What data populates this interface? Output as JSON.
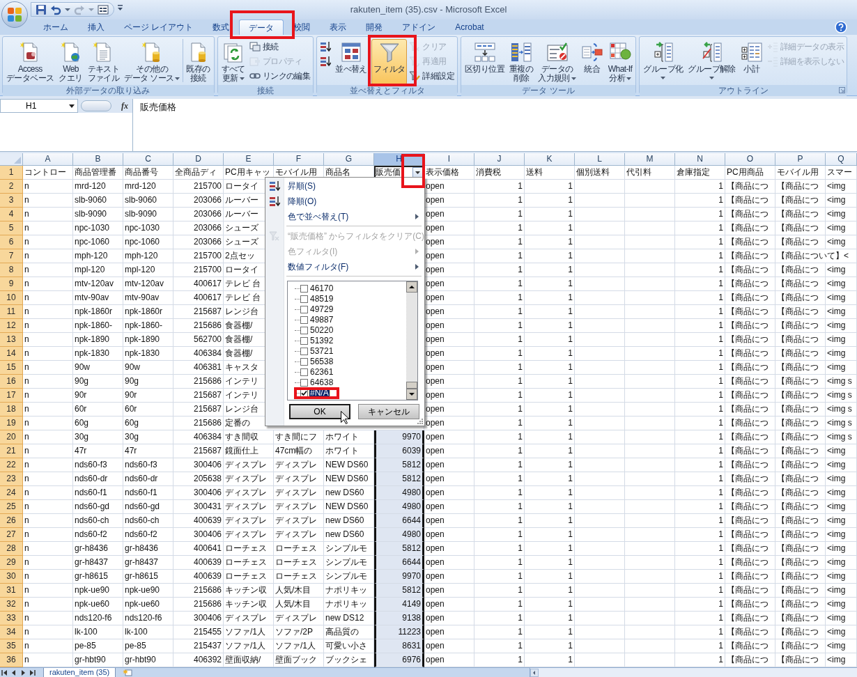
{
  "window": {
    "title": "rakuten_item (35).csv - Microsoft Excel"
  },
  "ribbon_tabs": [
    {
      "label": "ホーム",
      "selected": false,
      "highlighted": false
    },
    {
      "label": "挿入",
      "selected": false,
      "highlighted": false
    },
    {
      "label": "ページ レイアウト",
      "selected": false,
      "highlighted": false
    },
    {
      "label": "数式",
      "selected": false,
      "highlighted": false
    },
    {
      "label": "データ",
      "selected": true,
      "highlighted": true
    },
    {
      "label": "校閲",
      "selected": false,
      "highlighted": false
    },
    {
      "label": "表示",
      "selected": false,
      "highlighted": false
    },
    {
      "label": "開発",
      "selected": false,
      "highlighted": false
    },
    {
      "label": "アドイン",
      "selected": false,
      "highlighted": false
    },
    {
      "label": "Acrobat",
      "selected": false,
      "highlighted": false
    }
  ],
  "ribbon_groups": [
    {
      "label": "外部データの取り込み",
      "launcher": false,
      "items": [
        {
          "kind": "large",
          "lines": [
            "Access",
            "データベース"
          ],
          "disabled": false,
          "on": false,
          "menu": false,
          "highlighted": false
        },
        {
          "kind": "large",
          "lines": [
            "Web",
            "クエリ"
          ],
          "disabled": false,
          "on": false,
          "menu": false,
          "highlighted": false
        },
        {
          "kind": "large",
          "lines": [
            "テキスト",
            "ファイル"
          ],
          "disabled": false,
          "on": false,
          "menu": false,
          "highlighted": false
        },
        {
          "kind": "large",
          "lines": [
            "その他の",
            "データ ソース"
          ],
          "disabled": false,
          "on": false,
          "menu": true,
          "highlighted": false
        },
        {
          "kind": "divider"
        },
        {
          "kind": "large",
          "lines": [
            "既存の",
            "接続"
          ],
          "disabled": false,
          "on": false,
          "menu": false,
          "highlighted": false
        }
      ]
    },
    {
      "label": "接続",
      "launcher": false,
      "items": [
        {
          "kind": "large",
          "lines": [
            "すべて",
            "更新"
          ],
          "disabled": false,
          "on": false,
          "menu": true,
          "highlighted": false
        },
        {
          "kind": "small",
          "lines": [
            "接続"
          ],
          "disabled": false,
          "on": false,
          "menu": false,
          "highlighted": false
        },
        {
          "kind": "small",
          "lines": [
            "プロパティ"
          ],
          "disabled": true,
          "on": false,
          "menu": false,
          "highlighted": false
        },
        {
          "kind": "small",
          "lines": [
            "リンクの編集"
          ],
          "disabled": false,
          "on": false,
          "menu": false,
          "highlighted": false
        }
      ]
    },
    {
      "label": "並べ替えとフィルタ",
      "launcher": false,
      "items": [
        {
          "kind": "icon",
          "disabled": false,
          "on": false,
          "menu": false,
          "highlighted": false
        },
        {
          "kind": "icon",
          "disabled": false,
          "on": false,
          "menu": false,
          "highlighted": false
        },
        {
          "kind": "large",
          "lines": [
            "並べ替え"
          ],
          "disabled": false,
          "on": false,
          "menu": false,
          "highlighted": false
        },
        {
          "kind": "divider"
        },
        {
          "kind": "large",
          "lines": [
            "フィルタ"
          ],
          "disabled": false,
          "on": true,
          "menu": false,
          "highlighted": true
        },
        {
          "kind": "small",
          "lines": [
            "クリア"
          ],
          "disabled": true,
          "on": false,
          "menu": false,
          "highlighted": false
        },
        {
          "kind": "small",
          "lines": [
            "再適用"
          ],
          "disabled": true,
          "on": false,
          "menu": false,
          "highlighted": false
        },
        {
          "kind": "small",
          "lines": [
            "詳細設定"
          ],
          "disabled": false,
          "on": false,
          "menu": false,
          "highlighted": false
        }
      ]
    },
    {
      "label": "データ ツール",
      "launcher": false,
      "items": [
        {
          "kind": "large",
          "lines": [
            "区切り位置"
          ],
          "disabled": false,
          "on": false,
          "menu": false,
          "highlighted": false
        },
        {
          "kind": "large",
          "lines": [
            "重複の",
            "削除"
          ],
          "disabled": false,
          "on": false,
          "menu": false,
          "highlighted": false
        },
        {
          "kind": "large",
          "lines": [
            "データの",
            "入力規則"
          ],
          "disabled": false,
          "on": false,
          "menu": true,
          "highlighted": false
        },
        {
          "kind": "large",
          "lines": [
            "統合"
          ],
          "disabled": false,
          "on": false,
          "menu": false,
          "highlighted": false
        },
        {
          "kind": "large",
          "lines": [
            "What-If",
            "分析"
          ],
          "disabled": false,
          "on": false,
          "menu": true,
          "highlighted": false
        }
      ]
    },
    {
      "label": "アウトライン",
      "launcher": true,
      "items": [
        {
          "kind": "large",
          "lines": [
            "グループ化"
          ],
          "disabled": false,
          "on": false,
          "menu": true,
          "highlighted": false
        },
        {
          "kind": "large",
          "lines": [
            "グループ解除"
          ],
          "disabled": false,
          "on": false,
          "menu": true,
          "highlighted": false
        },
        {
          "kind": "large",
          "lines": [
            "小計"
          ],
          "disabled": false,
          "on": false,
          "menu": false,
          "highlighted": false
        },
        {
          "kind": "small",
          "lines": [
            "詳細データの表示"
          ],
          "disabled": true,
          "on": false,
          "menu": false,
          "highlighted": false
        },
        {
          "kind": "small",
          "lines": [
            "詳細を表示しない"
          ],
          "disabled": true,
          "on": false,
          "menu": false,
          "highlighted": false
        }
      ]
    }
  ],
  "formula_bar": {
    "cell_name": "H1",
    "function_button": "fx",
    "value": "販売価格"
  },
  "sheet": {
    "columns": [
      {
        "letter": "A",
        "selected": false,
        "filter_button": false,
        "highlighted": false
      },
      {
        "letter": "B",
        "selected": false,
        "filter_button": false,
        "highlighted": false
      },
      {
        "letter": "C",
        "selected": false,
        "filter_button": false,
        "highlighted": false
      },
      {
        "letter": "D",
        "selected": false,
        "filter_button": false,
        "highlighted": false
      },
      {
        "letter": "E",
        "selected": false,
        "filter_button": false,
        "highlighted": false
      },
      {
        "letter": "F",
        "selected": false,
        "filter_button": false,
        "highlighted": false
      },
      {
        "letter": "G",
        "selected": false,
        "filter_button": false,
        "highlighted": false
      },
      {
        "letter": "H",
        "selected": true,
        "filter_button": true,
        "highlighted": true
      },
      {
        "letter": "I",
        "selected": false,
        "filter_button": false,
        "highlighted": false
      },
      {
        "letter": "J",
        "selected": false,
        "filter_button": false,
        "highlighted": false
      },
      {
        "letter": "K",
        "selected": false,
        "filter_button": false,
        "highlighted": false
      },
      {
        "letter": "L",
        "selected": false,
        "filter_button": false,
        "highlighted": false
      },
      {
        "letter": "M",
        "selected": false,
        "filter_button": false,
        "highlighted": false
      },
      {
        "letter": "N",
        "selected": false,
        "filter_button": false,
        "highlighted": false
      },
      {
        "letter": "O",
        "selected": false,
        "filter_button": false,
        "highlighted": false
      },
      {
        "letter": "P",
        "selected": false,
        "filter_button": false,
        "highlighted": false
      },
      {
        "letter": "Q",
        "selected": false,
        "filter_button": false,
        "highlighted": false
      }
    ],
    "rows": [
      {
        "number": "1",
        "cells": [
          "コントロー",
          "商品管理番",
          "商品番号",
          "全商品ディ",
          "PC用キャッ",
          "モバイル用",
          "商品名",
          "販売価",
          "表示価格",
          "消費税",
          "送料",
          "個別送料",
          "代引料",
          "倉庫指定",
          "PC用商品",
          "モバイル用",
          "スマー"
        ]
      },
      {
        "number": "2",
        "cells": [
          "n",
          "mrd-120",
          "mrd-120",
          "215700",
          "ロータイ",
          null,
          null,
          null,
          "open",
          "1",
          "1",
          null,
          null,
          "1",
          "【商品につ",
          "【商品につ",
          "<img"
        ]
      },
      {
        "number": "3",
        "cells": [
          "n",
          "slb-9060",
          "slb-9060",
          "203066",
          "ルーバー",
          null,
          null,
          null,
          "open",
          "1",
          "1",
          null,
          null,
          "1",
          "【商品につ",
          "【商品につ",
          "<img"
        ]
      },
      {
        "number": "4",
        "cells": [
          "n",
          "slb-9090",
          "slb-9090",
          "203066",
          "ルーバー",
          null,
          null,
          null,
          "open",
          "1",
          "1",
          null,
          null,
          "1",
          "【商品につ",
          "【商品につ",
          "<img"
        ]
      },
      {
        "number": "5",
        "cells": [
          "n",
          "npc-1030",
          "npc-1030",
          "203066",
          "シューズ",
          null,
          null,
          null,
          "open",
          "1",
          "1",
          null,
          null,
          "1",
          "【商品につ",
          "【商品につ",
          "<img"
        ]
      },
      {
        "number": "6",
        "cells": [
          "n",
          "npc-1060",
          "npc-1060",
          "203066",
          "シューズ",
          null,
          null,
          null,
          "open",
          "1",
          "1",
          null,
          null,
          "1",
          "【商品につ",
          "【商品につ",
          "<img"
        ]
      },
      {
        "number": "7",
        "cells": [
          "n",
          "mph-120",
          "mph-120",
          "215700",
          "2点セッ",
          null,
          null,
          null,
          "open",
          "1",
          "1",
          null,
          null,
          "1",
          "【商品につ",
          "【商品について】<",
          null
        ]
      },
      {
        "number": "8",
        "cells": [
          "n",
          "mpl-120",
          "mpl-120",
          "215700",
          "ロータイ",
          null,
          null,
          null,
          "open",
          "1",
          "1",
          null,
          null,
          "1",
          "【商品につ",
          "【商品につ",
          "<img"
        ]
      },
      {
        "number": "9",
        "cells": [
          "n",
          "mtv-120av",
          "mtv-120av",
          "400617",
          "テレビ 台",
          null,
          null,
          null,
          "open",
          "1",
          "1",
          null,
          null,
          "1",
          "【商品につ",
          "【商品につ",
          "<img"
        ]
      },
      {
        "number": "10",
        "cells": [
          "n",
          "mtv-90av",
          "mtv-90av",
          "400617",
          "テレビ 台",
          null,
          null,
          null,
          "open",
          "1",
          "1",
          null,
          null,
          "1",
          "【商品につ",
          "【商品につ",
          "<img"
        ]
      },
      {
        "number": "11",
        "cells": [
          "n",
          "npk-1860r",
          "npk-1860r",
          "215687",
          "レンジ台",
          null,
          null,
          null,
          "open",
          "1",
          "1",
          null,
          null,
          "1",
          "【商品につ",
          "【商品につ",
          "<img"
        ]
      },
      {
        "number": "12",
        "cells": [
          "n",
          "npk-1860-",
          "npk-1860-",
          "215686",
          "食器棚/",
          null,
          null,
          null,
          "open",
          "1",
          "1",
          null,
          null,
          "1",
          "【商品につ",
          "【商品につ",
          "<img"
        ]
      },
      {
        "number": "13",
        "cells": [
          "n",
          "npk-1890",
          "npk-1890",
          "562700",
          "食器棚/",
          null,
          null,
          null,
          "open",
          "1",
          "1",
          null,
          null,
          "1",
          "【商品につ",
          "【商品につ",
          "<img"
        ]
      },
      {
        "number": "14",
        "cells": [
          "n",
          "npk-1830",
          "npk-1830",
          "406384",
          "食器棚/",
          null,
          null,
          null,
          "open",
          "1",
          "1",
          null,
          null,
          "1",
          "【商品につ",
          "【商品につ",
          "<img"
        ]
      },
      {
        "number": "15",
        "cells": [
          "n",
          "90w",
          "90w",
          "406381",
          "キャスタ",
          null,
          null,
          null,
          "open",
          "1",
          "1",
          null,
          null,
          "1",
          "【商品につ",
          "【商品につ",
          "<img"
        ]
      },
      {
        "number": "16",
        "cells": [
          "n",
          "90g",
          "90g",
          "215686",
          "インテリ",
          null,
          null,
          null,
          "open",
          "1",
          "1",
          null,
          null,
          "1",
          "【商品につ",
          "【商品につ",
          "<img s"
        ]
      },
      {
        "number": "17",
        "cells": [
          "n",
          "90r",
          "90r",
          "215687",
          "インテリ",
          null,
          null,
          null,
          "open",
          "1",
          "1",
          null,
          null,
          "1",
          "【商品につ",
          "【商品につ",
          "<img s"
        ]
      },
      {
        "number": "18",
        "cells": [
          "n",
          "60r",
          "60r",
          "215687",
          "レンジ台",
          null,
          null,
          null,
          "open",
          "1",
          "1",
          null,
          null,
          "1",
          "【商品につ",
          "【商品につ",
          "<img s"
        ]
      },
      {
        "number": "19",
        "cells": [
          "n",
          "60g",
          "60g",
          "215686",
          "定番の",
          null,
          null,
          null,
          "open",
          "1",
          "1",
          null,
          null,
          "1",
          "【商品につ",
          "【商品につ",
          "<img s"
        ]
      },
      {
        "number": "20",
        "cells": [
          "n",
          "30g",
          "30g",
          "406384",
          "すき間収",
          "すき間にフ",
          "ホワイト",
          "9970",
          "open",
          "1",
          "1",
          null,
          null,
          "1",
          "【商品につ",
          "【商品につ",
          "<img s"
        ]
      },
      {
        "number": "21",
        "cells": [
          "n",
          "47r",
          "47r",
          "215687",
          "鏡面仕上",
          "47cm幅の",
          "ホワイト",
          "6039",
          "open",
          "1",
          "1",
          null,
          null,
          "1",
          "【商品につ",
          "【商品につ",
          "<img"
        ]
      },
      {
        "number": "22",
        "cells": [
          "n",
          "nds60-f3",
          "nds60-f3",
          "300406",
          "ディスプレ",
          "ディスプレ",
          "NEW DS60",
          "5812",
          "open",
          "1",
          "1",
          null,
          null,
          "1",
          "【商品につ",
          "【商品につ",
          "<img"
        ]
      },
      {
        "number": "23",
        "cells": [
          "n",
          "nds60-dr",
          "nds60-dr",
          "205638",
          "ディスプレ",
          "ディスプレ",
          "NEW DS60",
          "5812",
          "open",
          "1",
          "1",
          null,
          null,
          "1",
          "【商品につ",
          "【商品につ",
          "<img"
        ]
      },
      {
        "number": "24",
        "cells": [
          "n",
          "nds60-f1",
          "nds60-f1",
          "300406",
          "ディスプレ",
          "ディスプレ",
          "new DS60",
          "4980",
          "open",
          "1",
          "1",
          null,
          null,
          "1",
          "【商品につ",
          "【商品につ",
          "<img"
        ]
      },
      {
        "number": "25",
        "cells": [
          "n",
          "nds60-gd",
          "nds60-gd",
          "300431",
          "ディスプレ",
          "ディスプレ",
          "NEW DS60",
          "4980",
          "open",
          "1",
          "1",
          null,
          null,
          "1",
          "【商品につ",
          "【商品につ",
          "<img"
        ]
      },
      {
        "number": "26",
        "cells": [
          "n",
          "nds60-ch",
          "nds60-ch",
          "400639",
          "ディスプレ",
          "ディスプレ",
          "new DS60",
          "6644",
          "open",
          "1",
          "1",
          null,
          null,
          "1",
          "【商品につ",
          "【商品につ",
          "<img"
        ]
      },
      {
        "number": "27",
        "cells": [
          "n",
          "nds60-f2",
          "nds60-f2",
          "300406",
          "ディスプレ",
          "ディスプレ",
          "new DS60",
          "4980",
          "open",
          "1",
          "1",
          null,
          null,
          "1",
          "【商品につ",
          "【商品につ",
          "<img"
        ]
      },
      {
        "number": "28",
        "cells": [
          "n",
          "gr-h8436",
          "gr-h8436",
          "400641",
          "ローチェス",
          "ローチェス",
          "シンプルモ",
          "5812",
          "open",
          "1",
          "1",
          null,
          null,
          "1",
          "【商品につ",
          "【商品につ",
          "<img"
        ]
      },
      {
        "number": "29",
        "cells": [
          "n",
          "gr-h8437",
          "gr-h8437",
          "400639",
          "ローチェス",
          "ローチェス",
          "シンプルモ",
          "6644",
          "open",
          "1",
          "1",
          null,
          null,
          "1",
          "【商品につ",
          "【商品につ",
          "<img"
        ]
      },
      {
        "number": "30",
        "cells": [
          "n",
          "gr-h8615",
          "gr-h8615",
          "400639",
          "ローチェス",
          "ローチェス",
          "シンプルモ",
          "9970",
          "open",
          "1",
          "1",
          null,
          null,
          "1",
          "【商品につ",
          "【商品につ",
          "<img"
        ]
      },
      {
        "number": "31",
        "cells": [
          "n",
          "npk-ue90",
          "npk-ue90",
          "215686",
          "キッチン収",
          "人気/木目",
          "ナポリキッ",
          "5812",
          "open",
          "1",
          "1",
          null,
          null,
          "1",
          "【商品につ",
          "【商品につ",
          "<img"
        ]
      },
      {
        "number": "32",
        "cells": [
          "n",
          "npk-ue60",
          "npk-ue60",
          "215686",
          "キッチン収",
          "人気/木目",
          "ナポリキッ",
          "4149",
          "open",
          "1",
          "1",
          null,
          null,
          "1",
          "【商品につ",
          "【商品につ",
          "<img"
        ]
      },
      {
        "number": "33",
        "cells": [
          "n",
          "nds120-f6",
          "nds120-f6",
          "300406",
          "ディスプレ",
          "ディスプレ",
          "new DS12",
          "9138",
          "open",
          "1",
          "1",
          null,
          null,
          "1",
          "【商品につ",
          "【商品につ",
          "<img"
        ]
      },
      {
        "number": "34",
        "cells": [
          "n",
          "lk-100",
          "lk-100",
          "215455",
          "ソファ/1人",
          "ソファ/2P",
          "高品質の",
          "11223",
          "open",
          "1",
          "1",
          null,
          null,
          "1",
          "【商品につ",
          "【商品につ",
          "<img"
        ]
      },
      {
        "number": "35",
        "cells": [
          "n",
          "pe-85",
          "pe-85",
          "215437",
          "ソファ/1人",
          "ソファ/1人",
          "可愛い小さ",
          "8631",
          "open",
          "1",
          "1",
          null,
          null,
          "1",
          "【商品につ",
          "【商品につ",
          "<img"
        ]
      },
      {
        "number": "36",
        "cells": [
          "n",
          "gr-hbt90",
          "gr-hbt90",
          "406392",
          "壁面収納/",
          "壁面ブック",
          "ブックシェ",
          "6976",
          "open",
          "1",
          "1",
          null,
          null,
          "1",
          "【商品につ",
          "【商品につ",
          "<img"
        ]
      }
    ]
  },
  "filter_menu": {
    "items": [
      {
        "kind": "item",
        "label": "昇順(S)",
        "disabled": false,
        "submenu": false
      },
      {
        "kind": "item",
        "label": "降順(O)",
        "disabled": false,
        "submenu": false
      },
      {
        "kind": "item",
        "label": "色で並べ替え(T)",
        "disabled": false,
        "submenu": true
      },
      {
        "kind": "separator"
      },
      {
        "kind": "item",
        "label": "“販売価格” からフィルタをクリア(C)",
        "disabled": true,
        "submenu": false
      },
      {
        "kind": "item",
        "label": "色フィルタ(I)",
        "disabled": true,
        "submenu": true
      },
      {
        "kind": "item",
        "label": "数値フィルタ(F)",
        "disabled": false,
        "submenu": true
      },
      {
        "kind": "separator"
      }
    ],
    "values": [
      {
        "label": "46170",
        "checked": false,
        "selected": false,
        "highlighted": false
      },
      {
        "label": "48519",
        "checked": false,
        "selected": false,
        "highlighted": false
      },
      {
        "label": "49729",
        "checked": false,
        "selected": false,
        "highlighted": false
      },
      {
        "label": "49887",
        "checked": false,
        "selected": false,
        "highlighted": false
      },
      {
        "label": "50220",
        "checked": false,
        "selected": false,
        "highlighted": false
      },
      {
        "label": "51392",
        "checked": false,
        "selected": false,
        "highlighted": false
      },
      {
        "label": "53721",
        "checked": false,
        "selected": false,
        "highlighted": false
      },
      {
        "label": "56538",
        "checked": false,
        "selected": false,
        "highlighted": false
      },
      {
        "label": "62361",
        "checked": false,
        "selected": false,
        "highlighted": false
      },
      {
        "label": "64638",
        "checked": false,
        "selected": false,
        "highlighted": false
      },
      {
        "label": "#N/A",
        "checked": true,
        "selected": true,
        "highlighted": true
      }
    ],
    "buttons": [
      {
        "label": "OK",
        "default": true
      },
      {
        "label": "キャンセル",
        "default": false
      }
    ]
  },
  "sheet_tabs": [
    {
      "label": "rakuten_item (35)",
      "selected": true
    }
  ]
}
